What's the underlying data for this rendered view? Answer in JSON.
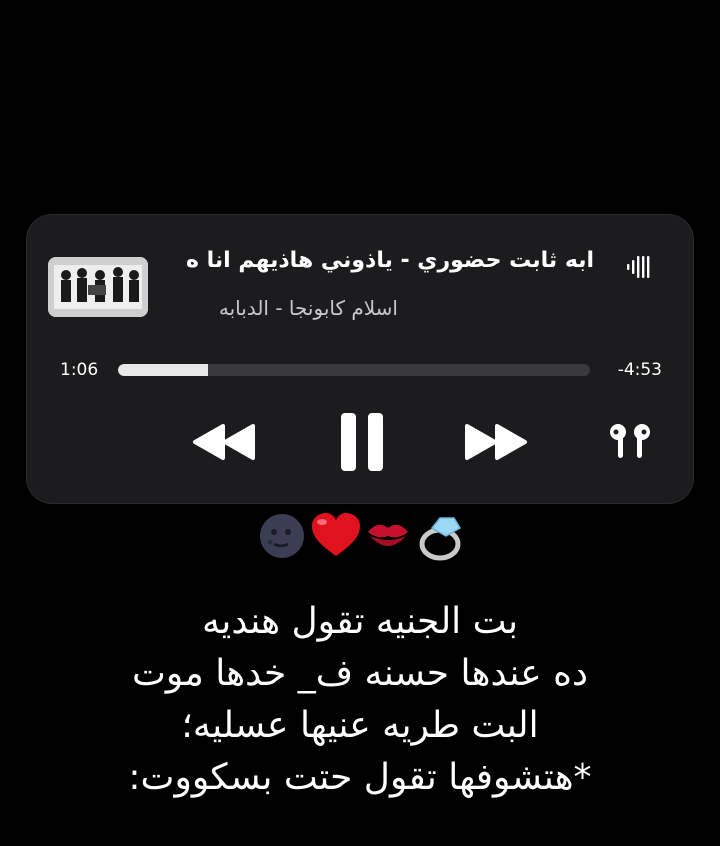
{
  "player": {
    "song_title": "ابه ثابت حضوري - ياذوني هاذيهم انا ه",
    "artist": "اسلام كابونجا - الدبابه",
    "elapsed": "1:06",
    "remaining": "-4:53",
    "progress_fraction": 0.19
  },
  "icons": {
    "artwork": "album-artwork",
    "wave": "audio-waveform-icon",
    "rewind": "rewind-icon",
    "pause": "pause-icon",
    "forward": "fast-forward-icon",
    "airpods": "airpods-icon"
  },
  "emojis": [
    "moon-face-emoji",
    "red-heart-emoji",
    "kiss-mark-emoji",
    "ring-emoji"
  ],
  "caption": {
    "line1": "بت الجنيه تقول هنديه",
    "line2": "ده عندها حسنه ف_ خدها موت",
    "line3": "البت طريه عنيها عسليه؛",
    "line4": "*هتشوفها تقول حتت بسكووت:"
  },
  "colors": {
    "background": "#000000",
    "card": "#1c1c1e",
    "progress_track": "#3a3a3c",
    "progress_fill": "#e8e8e8",
    "secondary_text": "#c7c7cc"
  }
}
